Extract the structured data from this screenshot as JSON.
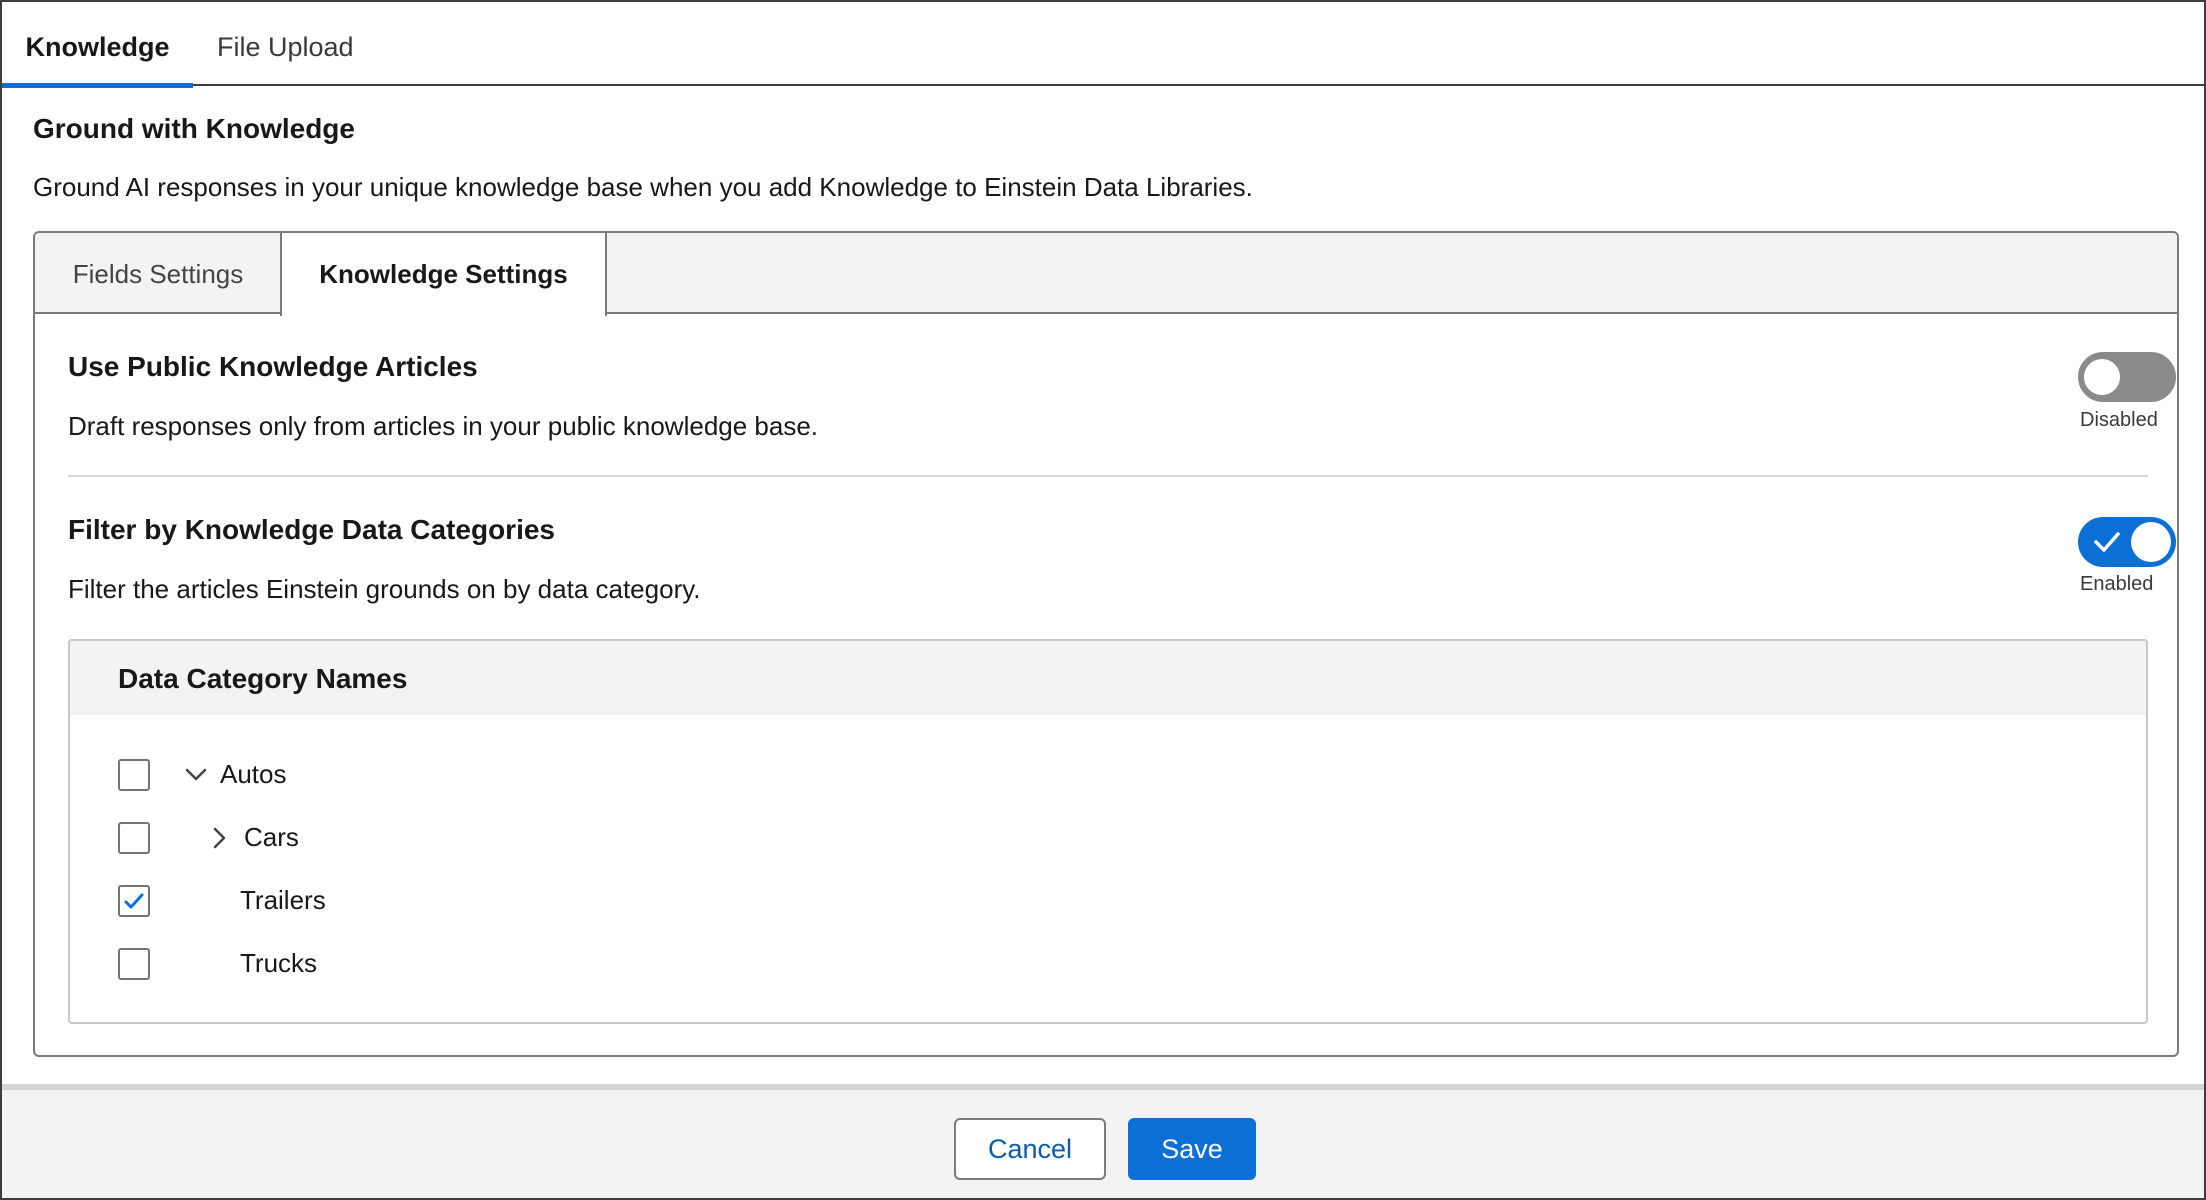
{
  "top_tabs": {
    "knowledge": "Knowledge",
    "file_upload": "File Upload"
  },
  "section": {
    "title": "Ground with Knowledge",
    "description": "Ground AI responses in your unique knowledge base when you add Knowledge to Einstein Data Libraries."
  },
  "card_tabs": {
    "fields_settings": "Fields Settings",
    "knowledge_settings": "Knowledge Settings"
  },
  "settings": {
    "public_articles": {
      "title": "Use Public Knowledge Articles",
      "description": "Draft responses only from articles in your public knowledge base.",
      "toggle_label": "Disabled",
      "enabled": false
    },
    "filter_categories": {
      "title": "Filter by Knowledge Data Categories",
      "description": "Filter the articles Einstein grounds on by data category.",
      "toggle_label": "Enabled",
      "enabled": true
    }
  },
  "categories": {
    "header": "Data Category Names",
    "items": [
      {
        "label": "Autos",
        "checked": false,
        "expander": "chevron-down-icon"
      },
      {
        "label": "Cars",
        "checked": false,
        "expander": "chevron-right-icon"
      },
      {
        "label": "Trailers",
        "checked": true
      },
      {
        "label": "Trucks",
        "checked": false
      }
    ]
  },
  "footer": {
    "cancel_label": "Cancel",
    "save_label": "Save"
  },
  "colors": {
    "brand": "#0b6fd6",
    "toggle_off": "#8a8a8a",
    "link": "#0b5cab"
  }
}
